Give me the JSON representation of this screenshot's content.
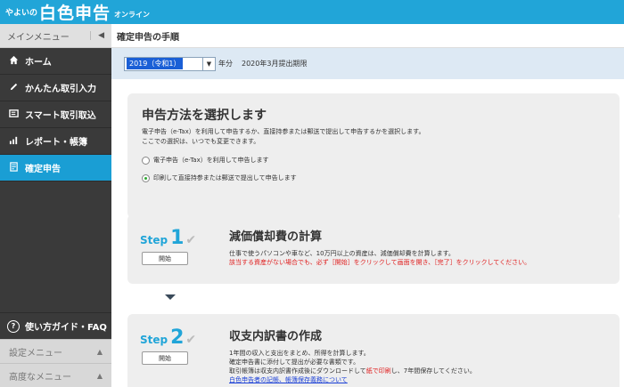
{
  "brand": {
    "small": "やよいの",
    "big": "白色申告",
    "online": "オンライン"
  },
  "sidebar": {
    "header": "メインメニュー",
    "collapse_icon": "chevron-left",
    "items": [
      {
        "label": "ホーム",
        "icon": "home-icon"
      },
      {
        "label": "かんたん取引入力",
        "icon": "pencil-icon"
      },
      {
        "label": "スマート取引取込",
        "icon": "import-icon"
      },
      {
        "label": "レポート・帳簿",
        "icon": "chart-icon"
      },
      {
        "label": "確定申告",
        "icon": "document-icon"
      }
    ],
    "guide": "使い方ガイド・FAQ",
    "settings_menu": "設定メニュー",
    "advanced_menu": "高度なメニュー",
    "active_color": "#1a9ed4"
  },
  "main": {
    "title": "確定申告の手順",
    "year": {
      "selected": "2019（令和1）",
      "suffix": "年分",
      "note": "2020年3月提出期限"
    },
    "method": {
      "heading": "申告方法を選択します",
      "desc1": "電子申告（e-Tax）を利用して申告するか、直接持参または郵送で提出して申告するかを選択します。",
      "desc2": "ここでの選択は、いつでも変更できます。",
      "option_etax": "電子申告（e-Tax）を利用して申告します",
      "option_paper": "印刷して直接持参または郵送で提出して申告します"
    },
    "step1": {
      "word": "Step",
      "num": "1",
      "button": "開始",
      "heading": "減価償却費の計算",
      "line1": "10万円以上の資産は、減価償却費を計算します。",
      "line1_prefix": "仕事で使うパソコンや車など、",
      "line2": "該当する資産がない場合でも、必ず［開始］をクリックして画面を開き、［完了］をクリックしてください。"
    },
    "step2": {
      "word": "Step",
      "num": "2",
      "button": "開始",
      "heading": "収支内訳書の作成",
      "line1": "1年間の収入と支出をまとめ、所得を計算します。",
      "line2": "確定申告書に添付して提出が必要な書類です。",
      "line3a": "取引帳簿は収支内訳書作成後にダウンロードして",
      "line3b": "紙で印刷",
      "line3c": "し、7年間保存してください。",
      "link": "白色申告者の記帳、帳簿保存義務について"
    },
    "accent": "#21a5d8"
  }
}
